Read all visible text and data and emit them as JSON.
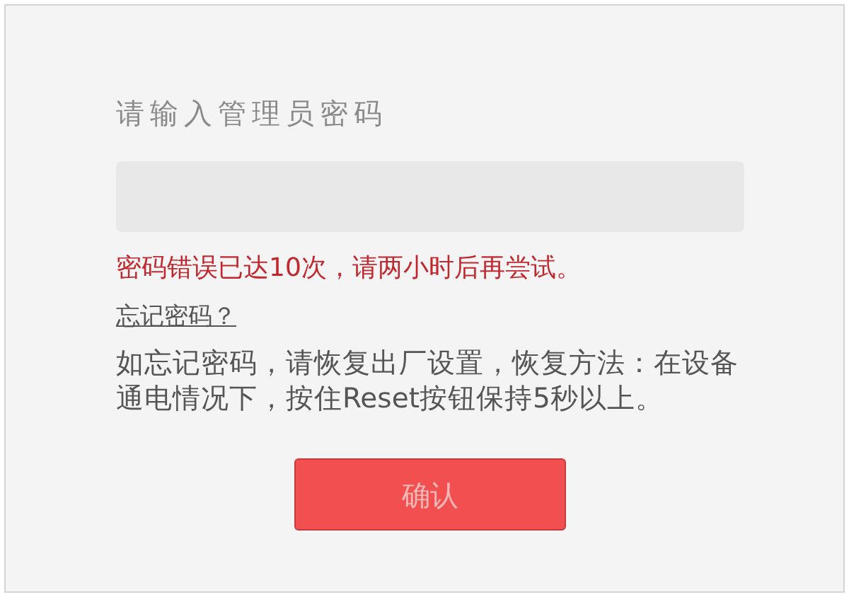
{
  "login": {
    "label": "请输入管理员密码",
    "password_field": {
      "disabled": true
    },
    "error": "密码错误已达10次，请两小时后再尝试。",
    "forgot_link": "忘记密码？",
    "help": "如忘记密码，请恢复出厂设置，恢复方法：在设备通电情况下，按住Reset按钮保持5秒以上。",
    "confirm_button": {
      "label": "确认",
      "disabled": true
    }
  }
}
